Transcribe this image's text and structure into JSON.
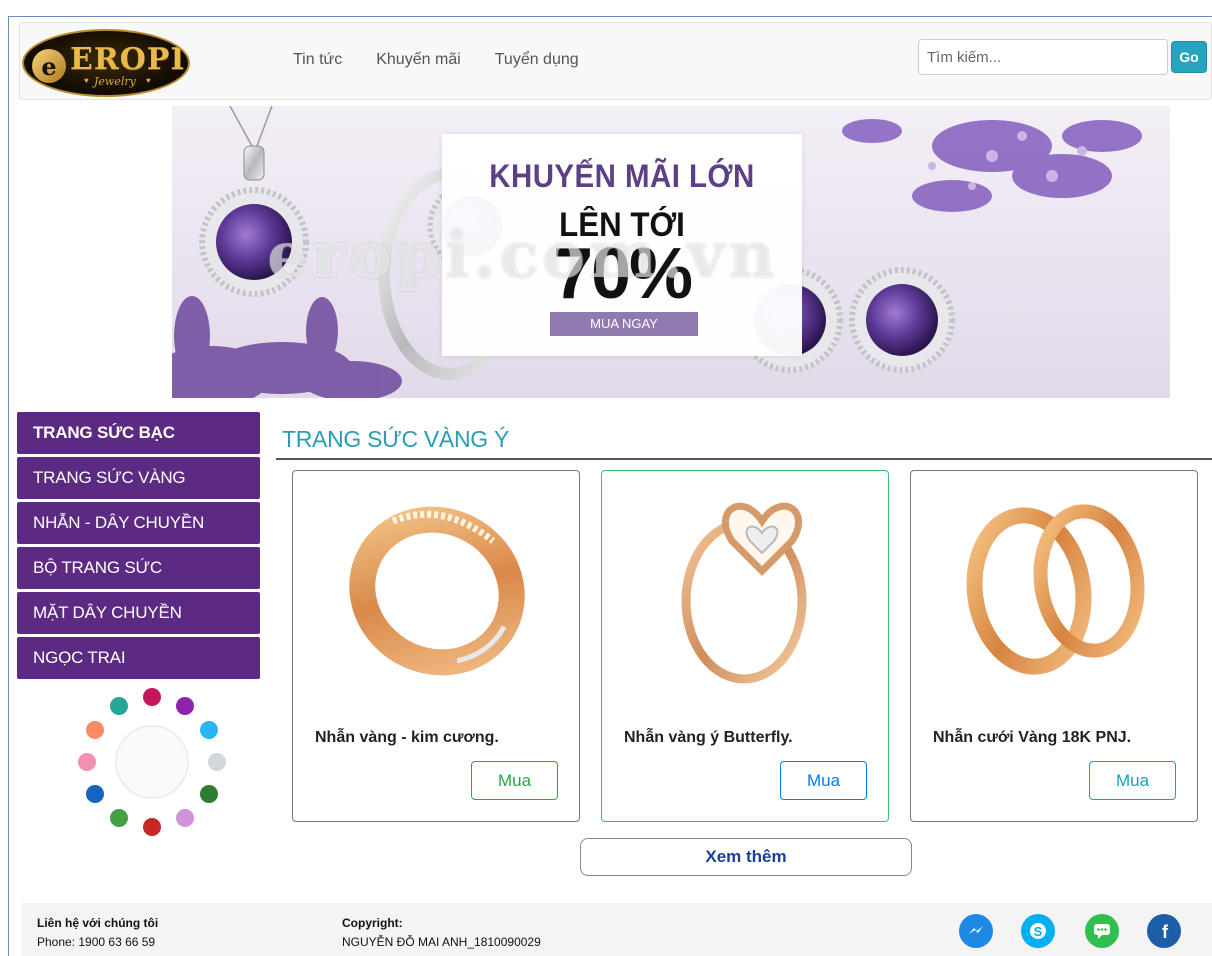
{
  "logo": {
    "brand": "EROPI",
    "tagline": "Jewelry",
    "mark": "e"
  },
  "nav": [
    {
      "label": "Tin tức"
    },
    {
      "label": "Khuyến mãi"
    },
    {
      "label": "Tuyển dụng"
    }
  ],
  "search": {
    "placeholder": "Tìm kiếm...",
    "button_label": "Go"
  },
  "banner": {
    "title": "KHUYẾN MÃI LỚN",
    "upto": "LÊN TỚI",
    "percent": "70%",
    "button_label": "MUA NGAY",
    "watermark": "eropi.com.vn"
  },
  "sidebar": {
    "items": [
      {
        "label": "TRANG SỨC BẠC"
      },
      {
        "label": "TRANG SỨC VÀNG"
      },
      {
        "label": "NHẪN - DÂY CHUYỀN"
      },
      {
        "label": "BỘ TRANG SỨC"
      },
      {
        "label": "MẶT DÂY CHUYỀN"
      },
      {
        "label": "NGỌC TRAI"
      }
    ]
  },
  "section": {
    "title": "TRANG SỨC VÀNG Ý"
  },
  "products": [
    {
      "name": "Nhẫn vàng - kim cương.",
      "buy_label": "Mua",
      "button_color": "#28a745"
    },
    {
      "name": "Nhẫn vàng ý Butterfly.",
      "buy_label": "Mua",
      "button_color": "#007bff"
    },
    {
      "name": "Nhẫn cưới Vàng 18K PNJ.",
      "buy_label": "Mua",
      "button_color": "#17a2b8"
    }
  ],
  "more_label": "Xem thêm",
  "footer": {
    "contact_title": "Liên hệ với chúng tôi",
    "phone": "Phone: 1900 63 66 59",
    "copyright_title": "Copyright:",
    "copyright_text": "NGUYỄN ĐỖ MAI ANH_1810090029",
    "social": [
      {
        "icon": "messenger-icon",
        "color": "#1e88e5"
      },
      {
        "icon": "skype-icon",
        "color": "#00aff0"
      },
      {
        "icon": "chat-icon",
        "color": "#2fbf4e"
      },
      {
        "icon": "facebook-icon",
        "color": "#1c5fa8"
      }
    ]
  },
  "colors": {
    "sidebar": "#5c2a82",
    "accent": "#2a9cb4",
    "go_button": "#28a3c0"
  }
}
